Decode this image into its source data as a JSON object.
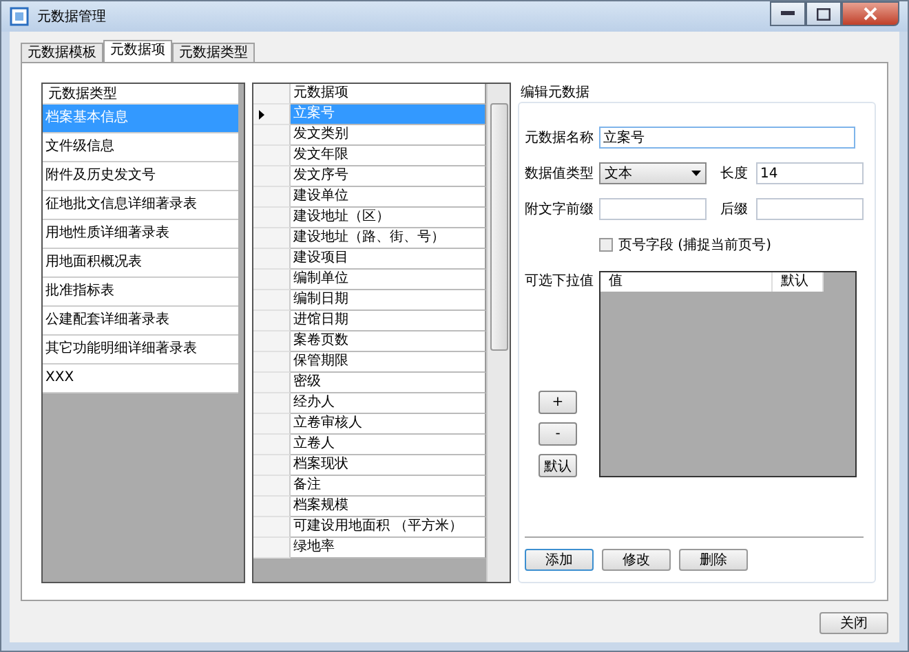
{
  "window": {
    "title": "元数据管理"
  },
  "tabs": [
    {
      "label": "元数据模板",
      "selected": false
    },
    {
      "label": "元数据项",
      "selected": true
    },
    {
      "label": "元数据类型",
      "selected": false
    }
  ],
  "type_list": {
    "header": "元数据类型",
    "items": [
      {
        "label": "档案基本信息",
        "selected": true
      },
      {
        "label": "文件级信息",
        "selected": false
      },
      {
        "label": "附件及历史发文号",
        "selected": false
      },
      {
        "label": "征地批文信息详细著录表",
        "selected": false
      },
      {
        "label": "用地性质详细著录表",
        "selected": false
      },
      {
        "label": "用地面积概况表",
        "selected": false
      },
      {
        "label": "批准指标表",
        "selected": false
      },
      {
        "label": "公建配套详细著录表",
        "selected": false
      },
      {
        "label": "其它功能明细详细著录表",
        "selected": false
      },
      {
        "label": "XXX",
        "selected": false
      }
    ]
  },
  "item_grid": {
    "header": "元数据项",
    "rows": [
      {
        "label": "立案号",
        "selected": true
      },
      {
        "label": "发文类别",
        "selected": false
      },
      {
        "label": "发文年限",
        "selected": false
      },
      {
        "label": "发文序号",
        "selected": false
      },
      {
        "label": "建设单位",
        "selected": false
      },
      {
        "label": "建设地址（区）",
        "selected": false
      },
      {
        "label": "建设地址（路、街、号）",
        "selected": false
      },
      {
        "label": "建设项目",
        "selected": false
      },
      {
        "label": "编制单位",
        "selected": false
      },
      {
        "label": "编制日期",
        "selected": false
      },
      {
        "label": "进馆日期",
        "selected": false
      },
      {
        "label": "案卷页数",
        "selected": false
      },
      {
        "label": "保管期限",
        "selected": false
      },
      {
        "label": "密级",
        "selected": false
      },
      {
        "label": "经办人",
        "selected": false
      },
      {
        "label": "立卷审核人",
        "selected": false
      },
      {
        "label": "立卷人",
        "selected": false
      },
      {
        "label": "档案现状",
        "selected": false
      },
      {
        "label": "备注",
        "selected": false
      },
      {
        "label": "档案规模",
        "selected": false
      },
      {
        "label": "可建设用地面积 （平方米）",
        "selected": false
      },
      {
        "label": "绿地率",
        "selected": false
      }
    ]
  },
  "editor": {
    "title": "编辑元数据",
    "name_label": "元数据名称",
    "name_value": "立案号",
    "type_label": "数据值类型",
    "type_value": "文本",
    "length_label": "长度",
    "length_value": "14",
    "prefix_label": "附文字前缀",
    "suffix_label": "后缀",
    "page_field": {
      "label": "页号字段 (捕捉当前页号)",
      "checked": false
    },
    "options_label": "可选下拉值",
    "options_columns": [
      "值",
      "默认"
    ],
    "side_buttons": [
      "+",
      "-",
      "默认"
    ],
    "actions": [
      "添加",
      "修改",
      "删除"
    ]
  },
  "footer": {
    "close": "关闭"
  }
}
